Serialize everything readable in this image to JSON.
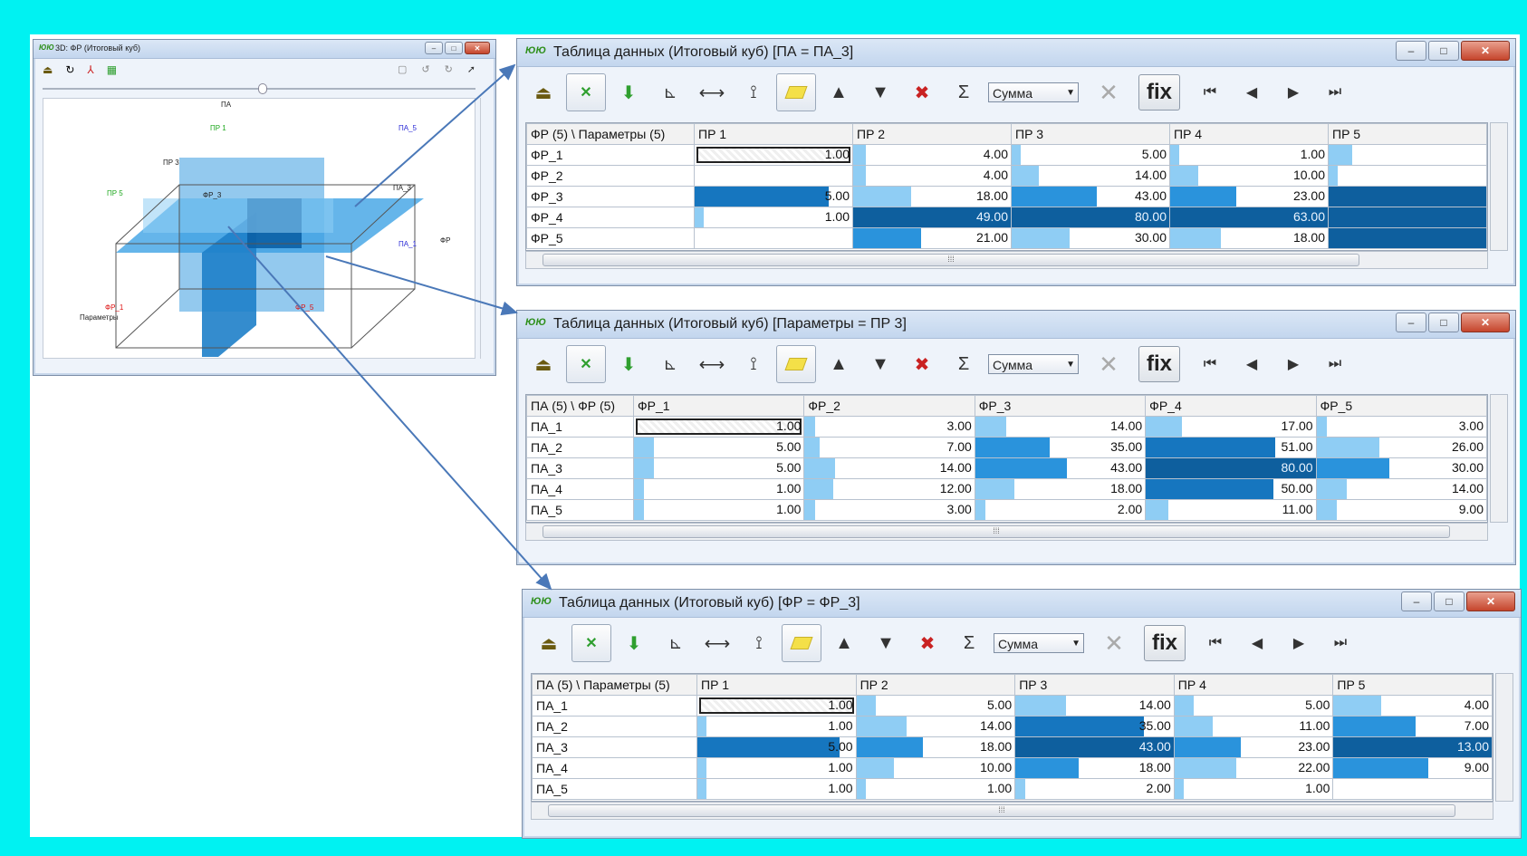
{
  "aggregate_options_selected": "Сумма",
  "fix_label": "fix",
  "cube_window": {
    "title": "3D: ФР (Итоговый куб)",
    "axis_labels": {
      "top": "ПА",
      "params": "Параметры",
      "pr1": "ПР 1",
      "pr3": "ПР 3",
      "pr5": "ПР 5",
      "pa5": "ПА_5",
      "pa3": "ПА_3",
      "pa1": "ПА_1",
      "fr3": "ФР_3",
      "fr1": "ФР_1",
      "fr5": "ФР_5",
      "fr": "ФР"
    }
  },
  "tables": [
    {
      "title": "Таблица данных (Итоговый куб) [ПА = ПА_3]",
      "corner": "ФР (5) \\ Параметры (5)",
      "columns": [
        "ПР 1",
        "ПР 2",
        "ПР 3",
        "ПР 4",
        "ПР 5"
      ],
      "rows": [
        {
          "label": "ФР_1",
          "values": [
            "1.00",
            "4.00",
            "5.00",
            "1.00",
            ""
          ],
          "levels": [
            0.01,
            0.08,
            0.06,
            0.02,
            0.15
          ]
        },
        {
          "label": "ФР_2",
          "values": [
            "",
            "4.00",
            "14.00",
            "10.00",
            ""
          ],
          "levels": [
            0,
            0.08,
            0.17,
            0.18,
            0.05
          ]
        },
        {
          "label": "ФР_3",
          "values": [
            "5.00",
            "18.00",
            "43.00",
            "23.00",
            ""
          ],
          "levels": [
            0.85,
            0.37,
            0.54,
            0.42,
            1.0
          ]
        },
        {
          "label": "ФР_4",
          "values": [
            "1.00",
            "49.00",
            "80.00",
            "63.00",
            ""
          ],
          "levels": [
            0.04,
            1.0,
            1.0,
            1.0,
            1.0
          ]
        },
        {
          "label": "ФР_5",
          "values": [
            "",
            "21.00",
            "30.00",
            "18.00",
            ""
          ],
          "levels": [
            0,
            0.43,
            0.37,
            0.32,
            1.0
          ]
        }
      ]
    },
    {
      "title": "Таблица данных (Итоговый куб) [Параметры = ПР 3]",
      "corner": "ПА (5) \\ ФР (5)",
      "columns": [
        "ФР_1",
        "ФР_2",
        "ФР_3",
        "ФР_4",
        "ФР_5"
      ],
      "rows": [
        {
          "label": "ПА_1",
          "values": [
            "1.00",
            "3.00",
            "14.00",
            "17.00",
            "3.00"
          ],
          "levels": [
            0.04,
            0.06,
            0.18,
            0.21,
            0.06
          ]
        },
        {
          "label": "ПА_2",
          "values": [
            "5.00",
            "7.00",
            "35.00",
            "51.00",
            "26.00"
          ],
          "levels": [
            0.12,
            0.09,
            0.44,
            0.76,
            0.37
          ]
        },
        {
          "label": "ПА_3",
          "values": [
            "5.00",
            "14.00",
            "43.00",
            "80.00",
            "30.00"
          ],
          "levels": [
            0.12,
            0.18,
            0.54,
            1.0,
            0.43
          ]
        },
        {
          "label": "ПА_4",
          "values": [
            "1.00",
            "12.00",
            "18.00",
            "50.00",
            "14.00"
          ],
          "levels": [
            0.06,
            0.17,
            0.23,
            0.75,
            0.18
          ]
        },
        {
          "label": "ПА_5",
          "values": [
            "1.00",
            "3.00",
            "2.00",
            "11.00",
            "9.00"
          ],
          "levels": [
            0.04,
            0.06,
            0.03,
            0.13,
            0.12
          ]
        }
      ]
    },
    {
      "title": "Таблица данных (Итоговый куб) [ФР = ФР_3]",
      "corner": "ПА (5) \\ Параметры (5)",
      "columns": [
        "ПР 1",
        "ПР 2",
        "ПР 3",
        "ПР 4",
        "ПР 5"
      ],
      "rows": [
        {
          "label": "ПА_1",
          "values": [
            "1.00",
            "5.00",
            "14.00",
            "5.00",
            "4.00"
          ],
          "levels": [
            0.02,
            0.12,
            0.32,
            0.12,
            0.3
          ]
        },
        {
          "label": "ПА_2",
          "values": [
            "1.00",
            "14.00",
            "35.00",
            "11.00",
            "7.00"
          ],
          "levels": [
            0.04,
            0.32,
            0.81,
            0.24,
            0.52
          ]
        },
        {
          "label": "ПА_3",
          "values": [
            "5.00",
            "18.00",
            "43.00",
            "23.00",
            "13.00"
          ],
          "levels": [
            0.9,
            0.42,
            1.0,
            0.42,
            1.0
          ]
        },
        {
          "label": "ПА_4",
          "values": [
            "1.00",
            "10.00",
            "18.00",
            "22.00",
            "9.00"
          ],
          "levels": [
            0.04,
            0.24,
            0.4,
            0.39,
            0.6
          ]
        },
        {
          "label": "ПА_5",
          "values": [
            "1.00",
            "1.00",
            "2.00",
            "1.00",
            ""
          ],
          "levels": [
            0.04,
            0.02,
            0.03,
            0.02,
            0
          ]
        }
      ]
    }
  ]
}
